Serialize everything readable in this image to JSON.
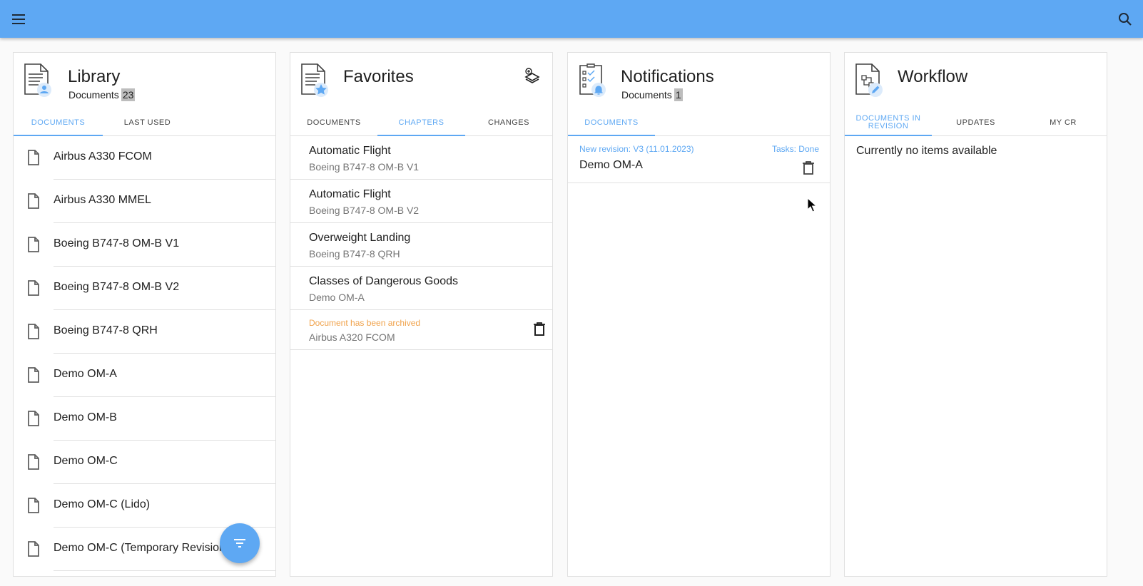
{
  "topbar": {
    "menu_icon": "menu-icon",
    "search_icon": "search-icon",
    "color": "#5ea8f3"
  },
  "library": {
    "title": "Library",
    "subtitle": "Documents",
    "count": "23",
    "tabs": [
      {
        "label": "DOCUMENTS",
        "active": true
      },
      {
        "label": "LAST USED",
        "active": false
      }
    ],
    "items": [
      "Airbus A330 FCOM",
      "Airbus A330 MMEL",
      "Boeing B747-8 OM-B V1",
      "Boeing B747-8 OM-B V2",
      "Boeing B747-8 QRH",
      "Demo OM-A",
      "Demo OM-B",
      "Demo OM-C",
      "Demo OM-C (Lido)",
      "Demo OM-C (Temporary Revision)"
    ]
  },
  "favorites": {
    "title": "Favorites",
    "tabs": [
      {
        "label": "DOCUMENTS",
        "active": false
      },
      {
        "label": "CHAPTERS",
        "active": true
      },
      {
        "label": "CHANGES",
        "active": false
      }
    ],
    "items": [
      {
        "title": "Automatic Flight",
        "doc": "Boeing B747-8 OM-B V1"
      },
      {
        "title": "Automatic Flight",
        "doc": "Boeing B747-8 OM-B V2"
      },
      {
        "title": "Overweight Landing",
        "doc": "Boeing B747-8 QRH"
      },
      {
        "title": "Classes of Dangerous Goods",
        "doc": "Demo OM-A"
      }
    ],
    "archived": {
      "notice": "Document has been archived",
      "doc": "Airbus A320 FCOM"
    }
  },
  "notifications": {
    "title": "Notifications",
    "subtitle": "Documents",
    "count": "1",
    "tabs": [
      {
        "label": "DOCUMENTS",
        "active": true
      }
    ],
    "items": [
      {
        "revision": "New revision: V3 (11.01.2023)",
        "tasks": "Tasks: Done",
        "name": "Demo OM-A"
      }
    ]
  },
  "workflow": {
    "title": "Workflow",
    "tabs": [
      {
        "label": "DOCUMENTS IN REVISION",
        "active": true
      },
      {
        "label": "UPDATES",
        "active": false
      },
      {
        "label": "MY CR",
        "active": false
      }
    ],
    "empty_text": "Currently no items available"
  },
  "fab": {
    "icon": "filter-icon"
  },
  "colors": {
    "accent": "#5ea8f3",
    "warning": "#f0a24b"
  }
}
